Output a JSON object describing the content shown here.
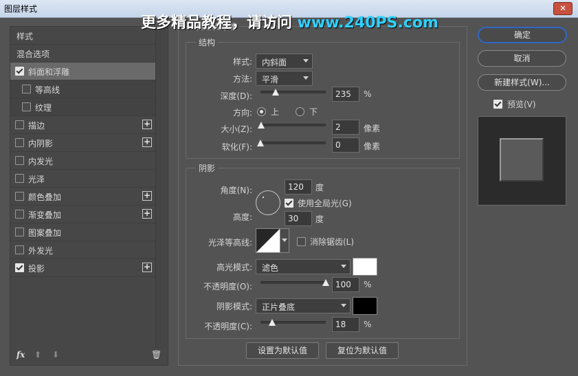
{
  "window": {
    "title": "图层样式",
    "close_symbol": "✕"
  },
  "watermark": {
    "text_cn": "更多精品教程，请访问 ",
    "text_url": "www.240PS.com"
  },
  "left": {
    "header": "样式",
    "blend_options": "混合选项",
    "items": [
      {
        "label": "斜面和浮雕",
        "checked": true,
        "plus": false,
        "selected": true
      },
      {
        "label": "等高线",
        "checked": false,
        "plus": false,
        "sub": true
      },
      {
        "label": "纹理",
        "checked": false,
        "plus": false,
        "sub": true
      },
      {
        "label": "描边",
        "checked": false,
        "plus": true
      },
      {
        "label": "内阴影",
        "checked": false,
        "plus": true
      },
      {
        "label": "内发光",
        "checked": false,
        "plus": false
      },
      {
        "label": "光泽",
        "checked": false,
        "plus": false
      },
      {
        "label": "颜色叠加",
        "checked": false,
        "plus": true
      },
      {
        "label": "渐变叠加",
        "checked": false,
        "plus": true
      },
      {
        "label": "图案叠加",
        "checked": false,
        "plus": false
      },
      {
        "label": "外发光",
        "checked": false,
        "plus": false
      },
      {
        "label": "投影",
        "checked": true,
        "plus": true
      }
    ],
    "plus_symbol": "+",
    "fx": "fx",
    "up_arrow": "⬆",
    "down_arrow": "⬇",
    "trash": "🗑"
  },
  "bevel": {
    "panel_title": "斜面和浮雕",
    "group_title": "结构",
    "style_label": "样式:",
    "style_value": "内斜面",
    "method_label": "方法:",
    "method_value": "平滑",
    "depth_label": "深度(D):",
    "depth_value": "235",
    "depth_unit": "%",
    "depth_pct": 0.235,
    "direction_label": "方向:",
    "dir_up": "上",
    "dir_down": "下",
    "size_label": "大小(Z):",
    "size_value": "2",
    "size_unit": "像素",
    "size_pct": 0.01,
    "soften_label": "软化(F):",
    "soften_value": "0",
    "soften_unit": "像素",
    "soften_pct": 0.0
  },
  "shading": {
    "group_title": "阴影",
    "angle_label": "角度(N):",
    "angle_value": "120",
    "angle_unit": "度",
    "global_light_label": "使用全局光(G)",
    "altitude_label": "高度:",
    "altitude_value": "30",
    "altitude_unit": "度",
    "gloss_label": "光泽等高线:",
    "anti_alias_label": "消除锯齿(L)",
    "highlight_mode_label": "高光模式:",
    "highlight_mode_value": "滤色",
    "highlight_color": "#ffffff",
    "hl_opacity_label": "不透明度(O):",
    "hl_opacity_value": "100",
    "hl_opacity_unit": "%",
    "hl_opacity_pct": 1.0,
    "shadow_mode_label": "阴影模式:",
    "shadow_mode_value": "正片叠底",
    "shadow_color": "#000000",
    "sh_opacity_label": "不透明度(C):",
    "sh_opacity_value": "18",
    "sh_opacity_unit": "%",
    "sh_opacity_pct": 0.18
  },
  "bottom_buttons": {
    "set_default": "设置为默认值",
    "reset_default": "复位为默认值"
  },
  "right": {
    "ok": "确定",
    "cancel": "取消",
    "new_style": "新建样式(W)...",
    "preview_label": "预览(V)"
  },
  "colors": {
    "panel_bg": "#535353",
    "accent_focus": "#2f67c6"
  }
}
